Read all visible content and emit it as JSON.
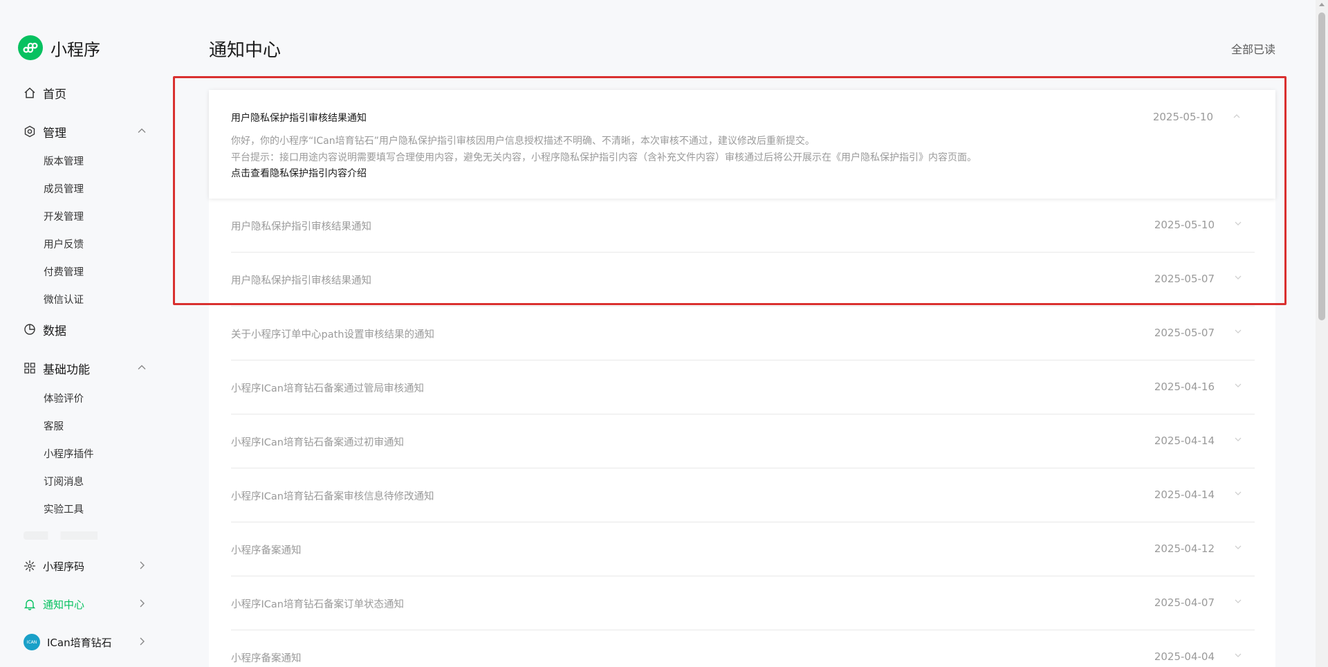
{
  "brand": {
    "name": "小程序"
  },
  "sidebar": {
    "home": "首页",
    "manage": {
      "label": "管理",
      "items": [
        "版本管理",
        "成员管理",
        "开发管理",
        "用户反馈",
        "付费管理",
        "微信认证"
      ]
    },
    "data": "数据",
    "basic": {
      "label": "基础功能",
      "items": [
        "体验评价",
        "客服",
        "小程序插件",
        "订阅消息",
        "实验工具"
      ]
    },
    "qrcode": "小程序码",
    "notify": "通知中心",
    "account": {
      "name": "ICan培育钻石",
      "avatar_text": "ICAN"
    }
  },
  "header": {
    "title": "通知中心",
    "mark_all_read": "全部已读"
  },
  "notifications": {
    "expanded": {
      "title": "用户隐私保护指引审核结果通知",
      "date": "2025-05-10",
      "line1": "你好，你的小程序“ICan培育钻石”用户隐私保护指引审核因用户信息授权描述不明确、不清晰，本次审核不通过，建议修改后重新提交。",
      "line2": "平台提示：接口用途内容说明需要填写合理使用内容，避免无关内容，小程序隐私保护指引内容（含补充文件内容）审核通过后将公开展示在《用户隐私保护指引》内容页面。",
      "link": "点击查看隐私保护指引内容介绍"
    },
    "items": [
      {
        "title": "用户隐私保护指引审核结果通知",
        "date": "2025-05-10"
      },
      {
        "title": "用户隐私保护指引审核结果通知",
        "date": "2025-05-07"
      },
      {
        "title": "关于小程序订单中心path设置审核结果的通知",
        "date": "2025-05-07"
      },
      {
        "title": "小程序ICan培育钻石备案通过管局审核通知",
        "date": "2025-04-16"
      },
      {
        "title": "小程序ICan培育钻石备案通过初审通知",
        "date": "2025-04-14"
      },
      {
        "title": "小程序ICan培育钻石备案审核信息待修改通知",
        "date": "2025-04-14"
      },
      {
        "title": "小程序备案通知",
        "date": "2025-04-12"
      },
      {
        "title": "小程序ICan培育钻石备案订单状态通知",
        "date": "2025-04-07"
      },
      {
        "title": "小程序备案通知",
        "date": "2025-04-04"
      }
    ]
  },
  "colors": {
    "accent": "#07c160",
    "highlight": "#d9302f"
  }
}
